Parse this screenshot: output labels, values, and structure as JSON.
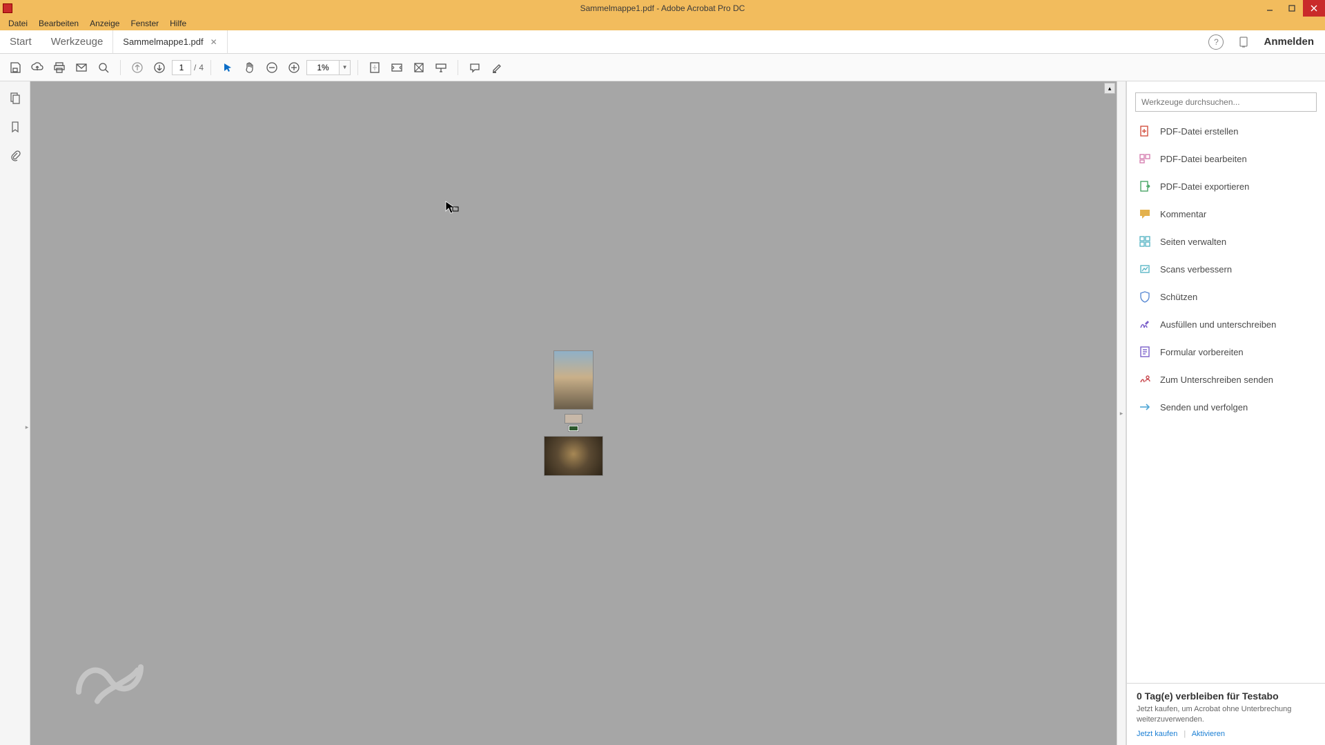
{
  "window": {
    "title": "Sammelmappe1.pdf - Adobe Acrobat Pro DC"
  },
  "menu": {
    "items": [
      "Datei",
      "Bearbeiten",
      "Anzeige",
      "Fenster",
      "Hilfe"
    ]
  },
  "tabs": {
    "start": "Start",
    "tools": "Werkzeuge",
    "document": "Sammelmappe1.pdf",
    "signin": "Anmelden"
  },
  "toolbar": {
    "page_current": "1",
    "page_sep": "/",
    "page_total": "4",
    "zoom": "1%"
  },
  "right_panel": {
    "search_placeholder": "Werkzeuge durchsuchen...",
    "tools": [
      {
        "label": "PDF-Datei erstellen",
        "icon": "create-pdf",
        "color": "#d34f3e"
      },
      {
        "label": "PDF-Datei bearbeiten",
        "icon": "edit-pdf",
        "color": "#d67fb0"
      },
      {
        "label": "PDF-Datei exportieren",
        "icon": "export-pdf",
        "color": "#4aa567"
      },
      {
        "label": "Kommentar",
        "icon": "comment",
        "color": "#e0a83a"
      },
      {
        "label": "Seiten verwalten",
        "icon": "organize-pages",
        "color": "#5bb7c6"
      },
      {
        "label": "Scans verbessern",
        "icon": "enhance-scans",
        "color": "#5bb7c6"
      },
      {
        "label": "Schützen",
        "icon": "protect",
        "color": "#5b8bd4"
      },
      {
        "label": "Ausfüllen und unterschreiben",
        "icon": "fill-sign",
        "color": "#7a5fc9"
      },
      {
        "label": "Formular vorbereiten",
        "icon": "prepare-form",
        "color": "#7a5fc9"
      },
      {
        "label": "Zum Unterschreiben senden",
        "icon": "send-sign",
        "color": "#c9484e"
      },
      {
        "label": "Senden und verfolgen",
        "icon": "send-track",
        "color": "#4fa6d6"
      }
    ]
  },
  "promo": {
    "title": "0 Tag(e) verbleiben für Testabo",
    "text": "Jetzt kaufen, um Acrobat ohne Unterbrechung weiterzuverwenden.",
    "link_buy": "Jetzt kaufen",
    "link_activate": "Aktivieren"
  }
}
